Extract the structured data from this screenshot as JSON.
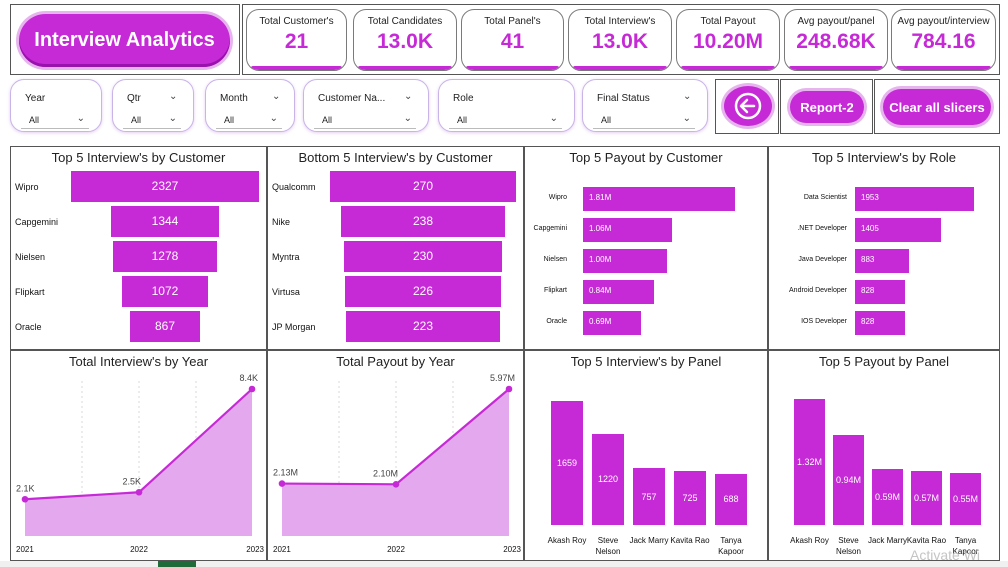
{
  "header": {
    "title": "Interview Analytics"
  },
  "kpis": [
    {
      "label": "Total Customer's",
      "value": "21"
    },
    {
      "label": "Total Candidates",
      "value": "13.0K"
    },
    {
      "label": "Total Panel's",
      "value": "41"
    },
    {
      "label": "Total Interview's",
      "value": "13.0K"
    },
    {
      "label": "Total Payout",
      "value": "10.20M"
    },
    {
      "label": "Avg payout/panel",
      "value": "248.68K"
    },
    {
      "label": "Avg payout/interview",
      "value": "784.16"
    }
  ],
  "slicers": [
    {
      "name": "Year",
      "value": "All"
    },
    {
      "name": "Qtr",
      "value": "All"
    },
    {
      "name": "Month",
      "value": "All"
    },
    {
      "name": "Customer Na...",
      "value": "All"
    },
    {
      "name": "Role",
      "value": "All"
    },
    {
      "name": "Final Status",
      "value": "All"
    }
  ],
  "buttons": {
    "back_icon": "arrow-left-icon",
    "report2": "Report-2",
    "clear": "Clear all slicers"
  },
  "colors": {
    "accent": "#c62ad6",
    "area_fill": "#e4a8ee"
  },
  "chart_data": [
    {
      "type": "bar",
      "title": "Top 5 Interview's by Customer",
      "categories": [
        "Wipro",
        "Capgemini",
        "Nielsen",
        "Flipkart",
        "Oracle"
      ],
      "values": [
        2327,
        1344,
        1278,
        1072,
        867
      ],
      "labels": [
        "2327",
        "1344",
        "1278",
        "1072",
        "867"
      ]
    },
    {
      "type": "bar",
      "title": "Bottom 5 Interview's by Customer",
      "categories": [
        "Qualcomm",
        "Nike",
        "Myntra",
        "Virtusa",
        "JP Morgan"
      ],
      "values": [
        270,
        238,
        230,
        226,
        223
      ],
      "labels": [
        "270",
        "238",
        "230",
        "226",
        "223"
      ]
    },
    {
      "type": "bar",
      "title": "Top 5 Payout by Customer",
      "categories": [
        "Wipro",
        "Capgemini",
        "Nielsen",
        "Flipkart",
        "Oracle"
      ],
      "values": [
        1.81,
        1.06,
        1.0,
        0.84,
        0.69
      ],
      "labels": [
        "1.81M",
        "1.06M",
        "1.00M",
        "0.84M",
        "0.69M"
      ]
    },
    {
      "type": "bar",
      "title": "Top 5 Interview's by Role",
      "categories": [
        "Data Scientist",
        ".NET Developer",
        "Java Developer",
        "Android Developer",
        "IOS Developer"
      ],
      "values": [
        1953,
        1405,
        883,
        828,
        828
      ],
      "labels": [
        "1953",
        "1405",
        "883",
        "828",
        "828"
      ]
    },
    {
      "type": "area",
      "title": "Total Interview's by Year",
      "x": [
        "2021",
        "2022",
        "2023"
      ],
      "values": [
        2.1,
        2.5,
        8.4
      ],
      "labels": [
        "2.1K",
        "2.5K",
        "8.4K"
      ]
    },
    {
      "type": "area",
      "title": "Total Payout by Year",
      "x": [
        "2021",
        "2022",
        "2023"
      ],
      "values": [
        2.13,
        2.1,
        5.97
      ],
      "labels": [
        "2.13M",
        "2.10M",
        "5.97M"
      ]
    },
    {
      "type": "bar",
      "title": "Top 5 Interview's by Panel",
      "categories": [
        [
          "Akash",
          "Roy"
        ],
        [
          "Steve",
          "Nelson"
        ],
        [
          "Jack",
          "Marry"
        ],
        [
          "Kavita",
          "Rao"
        ],
        [
          "Tanya",
          "Kapoor"
        ]
      ],
      "values": [
        1659,
        1220,
        757,
        725,
        688
      ],
      "labels": [
        "1659",
        "1220",
        "757",
        "725",
        "688"
      ]
    },
    {
      "type": "bar",
      "title": "Top 5 Payout by Panel",
      "categories": [
        [
          "Akash",
          "Roy"
        ],
        [
          "Steve",
          "Nelson"
        ],
        [
          "Jack",
          "Marry"
        ],
        [
          "Kavita",
          "Rao"
        ],
        [
          "Tanya",
          "Kapoor"
        ]
      ],
      "values": [
        1.32,
        0.94,
        0.59,
        0.57,
        0.55
      ],
      "labels": [
        "1.32M",
        "0.94M",
        "0.59M",
        "0.57M",
        "0.55M"
      ]
    }
  ],
  "watermark": "Activate Wi"
}
